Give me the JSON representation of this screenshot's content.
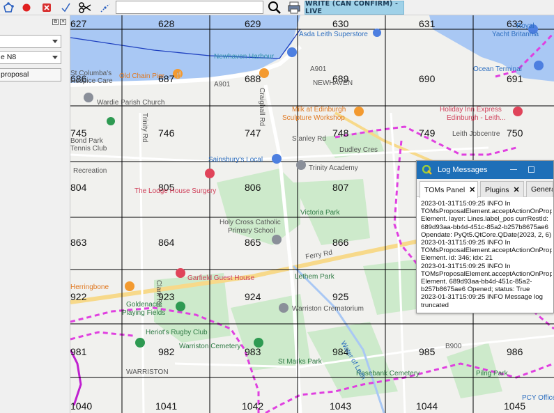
{
  "toolbar": {
    "search_value": "",
    "status_label": "WRITE (CAN CONFIRM) - LIVE"
  },
  "side_panel": {
    "combo_1_value": "",
    "combo_2_value": "e N8",
    "proposal_button_label": "proposal",
    "float_icon": "⧉",
    "close_icon": "✕"
  },
  "map": {
    "tiles": [
      {
        "label": "627"
      },
      {
        "label": "628"
      },
      {
        "label": "629"
      },
      {
        "label": "630"
      },
      {
        "label": "631"
      },
      {
        "label": "632"
      },
      {
        "label": "686"
      },
      {
        "label": "687"
      },
      {
        "label": "688"
      },
      {
        "label": "689"
      },
      {
        "label": "690"
      },
      {
        "label": "691"
      },
      {
        "label": "745"
      },
      {
        "label": "746"
      },
      {
        "label": "747"
      },
      {
        "label": "748"
      },
      {
        "label": "749"
      },
      {
        "label": "750"
      },
      {
        "label": "804"
      },
      {
        "label": "805"
      },
      {
        "label": "806"
      },
      {
        "label": "807"
      },
      {
        "label": "863"
      },
      {
        "label": "864"
      },
      {
        "label": "865"
      },
      {
        "label": "866"
      },
      {
        "label": "922"
      },
      {
        "label": "923"
      },
      {
        "label": "924"
      },
      {
        "label": "925"
      },
      {
        "label": "981"
      },
      {
        "label": "982"
      },
      {
        "label": "983"
      },
      {
        "label": "984"
      },
      {
        "label": "985"
      },
      {
        "label": "986"
      },
      {
        "label": "1040"
      },
      {
        "label": "1041"
      },
      {
        "label": "1042"
      },
      {
        "label": "1043"
      },
      {
        "label": "1044"
      },
      {
        "label": "1045"
      }
    ],
    "places": [
      {
        "text": "Newhaven Harbour"
      },
      {
        "text": "Asda Leith Superstore"
      },
      {
        "text": "Royal"
      },
      {
        "text": "Yacht Britannia"
      },
      {
        "text": "Ocean Terminal"
      },
      {
        "text": "Old Chain Pier"
      },
      {
        "text": "St Columba's"
      },
      {
        "text": "Hospice Care"
      },
      {
        "text": "Wardie Parish Church"
      },
      {
        "text": "Milk at Edinburgh"
      },
      {
        "text": "Sculpture Workshop"
      },
      {
        "text": "Holiday Inn Express"
      },
      {
        "text": "Edinburgh - Leith..."
      },
      {
        "text": "Leith Jobcentre"
      },
      {
        "text": "Bond Park"
      },
      {
        "text": "Tennis Club"
      },
      {
        "text": "Sainsbury's Local"
      },
      {
        "text": "Trinity Academy"
      },
      {
        "text": "Recreation"
      },
      {
        "text": "The Lodge House Surgery"
      },
      {
        "text": "Holy Cross Catholic"
      },
      {
        "text": "Primary School"
      },
      {
        "text": "Victoria Park"
      },
      {
        "text": "Garfield Guest House"
      },
      {
        "text": "Lethem Park"
      },
      {
        "text": "Herringbone"
      },
      {
        "text": "Goldenacre"
      },
      {
        "text": "Playing Fields"
      },
      {
        "text": "Warriston Crematorium"
      },
      {
        "text": "Heriot's Rugby Club"
      },
      {
        "text": "Warriston Cemetery"
      },
      {
        "text": "St Marks Park"
      },
      {
        "text": "Rosebank Cemetery"
      },
      {
        "text": "Pilrig Park"
      },
      {
        "text": "PCY Offices"
      },
      {
        "text": "Water of Leith"
      }
    ],
    "roads": [
      {
        "text": "A901"
      },
      {
        "text": "A901"
      },
      {
        "text": "NEWHAVEN"
      },
      {
        "text": "Craighall Rd"
      },
      {
        "text": "Ferry Rd"
      },
      {
        "text": "Dudley Cres"
      },
      {
        "text": "Stanley Rd"
      },
      {
        "text": "WARRISTON"
      },
      {
        "text": "B900"
      },
      {
        "text": "Trinity Rd"
      },
      {
        "text": "Clark Rd"
      }
    ]
  },
  "log_window": {
    "title": "Log Messages",
    "tabs": [
      {
        "label": "TOMs Panel"
      },
      {
        "label": "Plugins"
      },
      {
        "label": "Genera"
      }
    ],
    "lines": [
      "2023-01-31T15:09:25     INFO    In",
      "TOMsProposalElement.acceptActionOnProposal.",
      "Element. layer: Lines.label_pos currRestId:",
      "689d93aa-bb4d-451c-85a2-b257b8675ae6",
      "Opendate: PyQt5.QtCore.QDate(2023, 2, 6)",
      "2023-01-31T15:09:25     INFO    In",
      "TOMsProposalElement.acceptActionOnProposal.",
      "Element. id: 346; idx: 21",
      "2023-01-31T15:09:25     INFO    In",
      "TOMsProposalElement.acceptActionOnProposal.",
      "Element. 689d93aa-bb4d-451c-85a2-",
      "b257b8675ae6 Opened; status: True",
      "2023-01-31T15:09:25     INFO    Message log",
      "truncated"
    ]
  },
  "colors": {
    "water": "#a9c8f4",
    "park": "#cdeacb",
    "grid": "#000000",
    "boundary": "#e040e0",
    "road_major": "#f7d98a",
    "road": "#ffffff",
    "log_title": "#1e6fb8",
    "status_label_bg": "#9fd1e8"
  }
}
